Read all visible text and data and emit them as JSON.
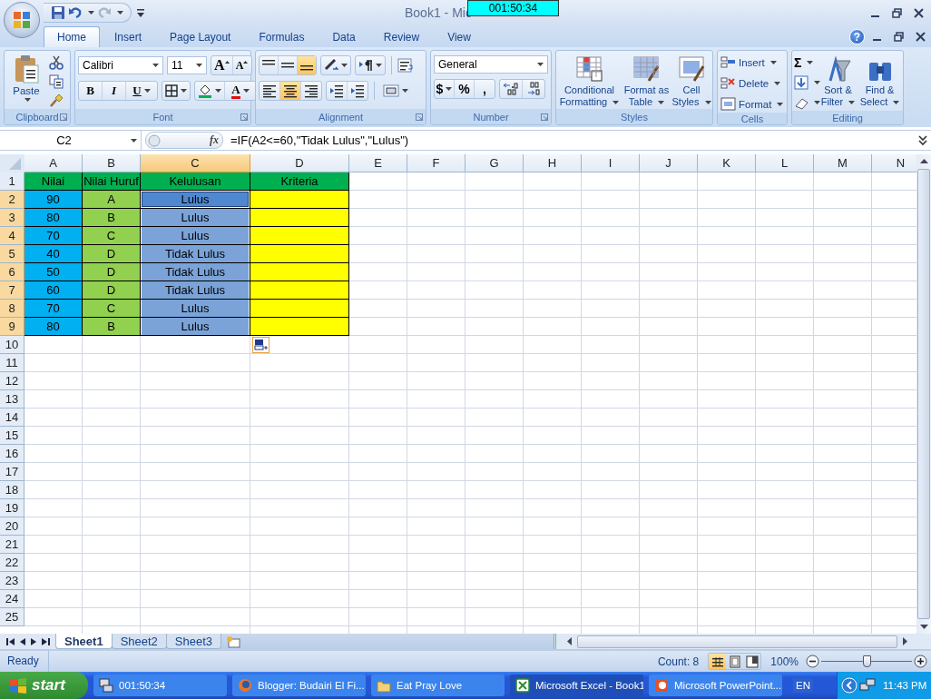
{
  "window": {
    "title": "Book1 - Mic",
    "timer": "001:50:34"
  },
  "ribbon_tabs": [
    {
      "label": "Home",
      "selected": true
    },
    {
      "label": "Insert",
      "selected": false
    },
    {
      "label": "Page Layout",
      "selected": false
    },
    {
      "label": "Formulas",
      "selected": false
    },
    {
      "label": "Data",
      "selected": false
    },
    {
      "label": "Review",
      "selected": false
    },
    {
      "label": "View",
      "selected": false
    }
  ],
  "help": "?",
  "ribbon": {
    "clipboard": {
      "label": "Clipboard",
      "paste": "Paste"
    },
    "font": {
      "label": "Font",
      "font_name": "Calibri",
      "font_size": "11",
      "grow": "A",
      "shrink": "A",
      "bold": "B",
      "italic": "I",
      "underline": "U",
      "font_color": "A"
    },
    "alignment": {
      "label": "Alignment",
      "vertical": [
        {
          "selected": false
        },
        {
          "selected": false
        },
        {
          "selected": true
        }
      ],
      "horizontal": [
        {
          "selected": false
        },
        {
          "selected": true
        },
        {
          "selected": false
        }
      ]
    },
    "number": {
      "label": "Number",
      "format": "General",
      "currency": "$",
      "percent": "%",
      "comma": ","
    },
    "styles": {
      "label": "Styles",
      "buttons": [
        {
          "label": "Conditional Formatting",
          "kind": "conditional"
        },
        {
          "label": "Format as Table",
          "kind": "table"
        },
        {
          "label": "Cell Styles",
          "kind": "cell"
        }
      ]
    },
    "cells": {
      "label": "Cells",
      "buttons": [
        {
          "label": "Insert",
          "kind": "insert"
        },
        {
          "label": "Delete",
          "kind": "delete"
        },
        {
          "label": "Format",
          "kind": "format"
        }
      ]
    },
    "editing": {
      "label": "Editing",
      "sum": "Σ",
      "buttons": [
        {
          "label": "Sort & Filter",
          "kind": "sort"
        },
        {
          "label": "Find & Select",
          "kind": "find"
        }
      ]
    }
  },
  "formula_bar": {
    "name_box": "C2",
    "fx": "fx",
    "formula": "=IF(A2<=60,\"Tidak Lulus\",\"Lulus\")"
  },
  "sheet": {
    "columns": [
      {
        "label": "A",
        "selected": false
      },
      {
        "label": "B",
        "selected": false
      },
      {
        "label": "C",
        "selected": true
      },
      {
        "label": "D",
        "selected": false
      },
      {
        "label": "E",
        "selected": false
      },
      {
        "label": "F",
        "selected": false
      },
      {
        "label": "G",
        "selected": false
      },
      {
        "label": "H",
        "selected": false
      },
      {
        "label": "I",
        "selected": false
      },
      {
        "label": "J",
        "selected": false
      },
      {
        "label": "K",
        "selected": false
      },
      {
        "label": "L",
        "selected": false
      },
      {
        "label": "M",
        "selected": false
      },
      {
        "label": "N",
        "selected": false
      }
    ],
    "row_headers": [
      {
        "label": "1",
        "selected": false
      },
      {
        "label": "2",
        "selected": true
      },
      {
        "label": "3",
        "selected": true
      },
      {
        "label": "4",
        "selected": true
      },
      {
        "label": "5",
        "selected": true
      },
      {
        "label": "6",
        "selected": true
      },
      {
        "label": "7",
        "selected": true
      },
      {
        "label": "8",
        "selected": true
      },
      {
        "label": "9",
        "selected": true
      },
      {
        "label": "10",
        "selected": false
      },
      {
        "label": "11",
        "selected": false
      },
      {
        "label": "12",
        "selected": false
      },
      {
        "label": "13",
        "selected": false
      },
      {
        "label": "14",
        "selected": false
      },
      {
        "label": "15",
        "selected": false
      },
      {
        "label": "16",
        "selected": false
      },
      {
        "label": "17",
        "selected": false
      },
      {
        "label": "18",
        "selected": false
      },
      {
        "label": "19",
        "selected": false
      },
      {
        "label": "20",
        "selected": false
      },
      {
        "label": "21",
        "selected": false
      },
      {
        "label": "22",
        "selected": false
      },
      {
        "label": "23",
        "selected": false
      },
      {
        "label": "24",
        "selected": false
      },
      {
        "label": "25",
        "selected": false
      }
    ],
    "rows": [
      {
        "cells": [
          {
            "text": "Nilai",
            "color": "#00b050",
            "selected": false,
            "active": false
          },
          {
            "text": "Nilai Huruf",
            "color": "#00b050",
            "selected": false,
            "active": false
          },
          {
            "text": "Kelulusan",
            "color": "#00b050",
            "selected": false,
            "active": false
          },
          {
            "text": "Kriteria",
            "color": "#00b050",
            "selected": false,
            "active": false
          }
        ]
      },
      {
        "cells": [
          {
            "text": "90",
            "color": "#00b0f0",
            "selected": false,
            "active": false
          },
          {
            "text": "A",
            "color": "#92d050",
            "selected": false,
            "active": false
          },
          {
            "text": "Lulus",
            "color": "#4f88cf",
            "selected": true,
            "active": true
          },
          {
            "color": "#ffff00",
            "selected": false,
            "active": false
          }
        ]
      },
      {
        "cells": [
          {
            "text": "80",
            "color": "#00b0f0",
            "selected": false,
            "active": false
          },
          {
            "text": "B",
            "color": "#92d050",
            "selected": false,
            "active": false
          },
          {
            "text": "Lulus",
            "color": "#7ba3d8",
            "selected": true,
            "active": false
          },
          {
            "color": "#ffff00",
            "selected": false,
            "active": false
          }
        ]
      },
      {
        "cells": [
          {
            "text": "70",
            "color": "#00b0f0",
            "selected": false,
            "active": false
          },
          {
            "text": "C",
            "color": "#92d050",
            "selected": false,
            "active": false
          },
          {
            "text": "Lulus",
            "color": "#7ba3d8",
            "selected": true,
            "active": false
          },
          {
            "color": "#ffff00",
            "selected": false,
            "active": false
          }
        ]
      },
      {
        "cells": [
          {
            "text": "40",
            "color": "#00b0f0",
            "selected": false,
            "active": false
          },
          {
            "text": "D",
            "color": "#92d050",
            "selected": false,
            "active": false
          },
          {
            "text": "Tidak Lulus",
            "color": "#7ba3d8",
            "selected": true,
            "active": false
          },
          {
            "color": "#ffff00",
            "selected": false,
            "active": false
          }
        ]
      },
      {
        "cells": [
          {
            "text": "50",
            "color": "#00b0f0",
            "selected": false,
            "active": false
          },
          {
            "text": "D",
            "color": "#92d050",
            "selected": false,
            "active": false
          },
          {
            "text": "Tidak Lulus",
            "color": "#7ba3d8",
            "selected": true,
            "active": false
          },
          {
            "color": "#ffff00",
            "selected": false,
            "active": false
          }
        ]
      },
      {
        "cells": [
          {
            "text": "60",
            "color": "#00b0f0",
            "selected": false,
            "active": false
          },
          {
            "text": "D",
            "color": "#92d050",
            "selected": false,
            "active": false
          },
          {
            "text": "Tidak Lulus",
            "color": "#7ba3d8",
            "selected": true,
            "active": false
          },
          {
            "color": "#ffff00",
            "selected": false,
            "active": false
          }
        ]
      },
      {
        "cells": [
          {
            "text": "70",
            "color": "#00b0f0",
            "selected": false,
            "active": false
          },
          {
            "text": "C",
            "color": "#92d050",
            "selected": false,
            "active": false
          },
          {
            "text": "Lulus",
            "color": "#7ba3d8",
            "selected": true,
            "active": false
          },
          {
            "color": "#ffff00",
            "selected": false,
            "active": false
          }
        ]
      },
      {
        "cells": [
          {
            "text": "80",
            "color": "#00b0f0",
            "selected": false,
            "active": false
          },
          {
            "text": "B",
            "color": "#92d050",
            "selected": false,
            "active": false
          },
          {
            "text": "Lulus",
            "color": "#7ba3d8",
            "selected": true,
            "active": false
          },
          {
            "color": "#ffff00",
            "selected": false,
            "active": false
          }
        ]
      }
    ]
  },
  "sheet_tabs": [
    {
      "label": "Sheet1",
      "selected": true
    },
    {
      "label": "Sheet2",
      "selected": false
    },
    {
      "label": "Sheet3",
      "selected": false
    }
  ],
  "status_bar": {
    "ready": "Ready",
    "count": "Count: 8",
    "views": [
      {
        "selected": true
      },
      {
        "selected": false
      },
      {
        "selected": false
      }
    ],
    "zoom": "100%",
    "zoom_slider": {
      "level": 0.5
    }
  },
  "taskbar": {
    "start": "start",
    "tasks": [
      {
        "label": "001:50:34",
        "kind": "network",
        "selected": false
      },
      {
        "label": "Blogger: Budairi El Fi...",
        "kind": "browser",
        "selected": false
      },
      {
        "label": "Eat Pray Love",
        "kind": "folder",
        "selected": false
      },
      {
        "label": "Microsoft Excel - Book1",
        "kind": "excel",
        "selected": true
      },
      {
        "label": "Microsoft PowerPoint...",
        "kind": "powerpoint",
        "selected": false
      }
    ],
    "language": "EN",
    "clock": "11:43 PM"
  }
}
